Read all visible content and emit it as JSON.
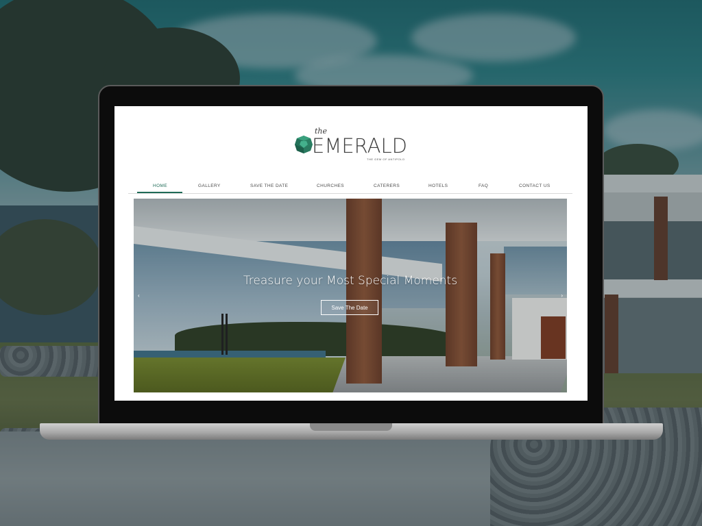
{
  "site": {
    "logo": {
      "prefix": "the",
      "name": "EMERALD",
      "tagline": "THE GEM OF ANTIPOLO"
    },
    "nav": {
      "items": [
        {
          "label": "HOME",
          "active": true
        },
        {
          "label": "GALLERY",
          "active": false
        },
        {
          "label": "SAVE THE DATE",
          "active": false
        },
        {
          "label": "CHURCHES",
          "active": false
        },
        {
          "label": "CATERERS",
          "active": false
        },
        {
          "label": "HOTELS",
          "active": false
        },
        {
          "label": "FAQ",
          "active": false
        },
        {
          "label": "CONTACT US",
          "active": false
        }
      ]
    },
    "hero": {
      "title": "Treasure your Most Special Moments",
      "button_label": "Save The Date",
      "prev_arrow": "‹",
      "next_arrow": "›"
    }
  },
  "icons": {
    "logo": "emerald-gem-icon",
    "prev": "chevron-left-icon",
    "next": "chevron-right-icon"
  },
  "colors": {
    "accent": "#1f6b57",
    "gem": "#2e8a6c"
  }
}
